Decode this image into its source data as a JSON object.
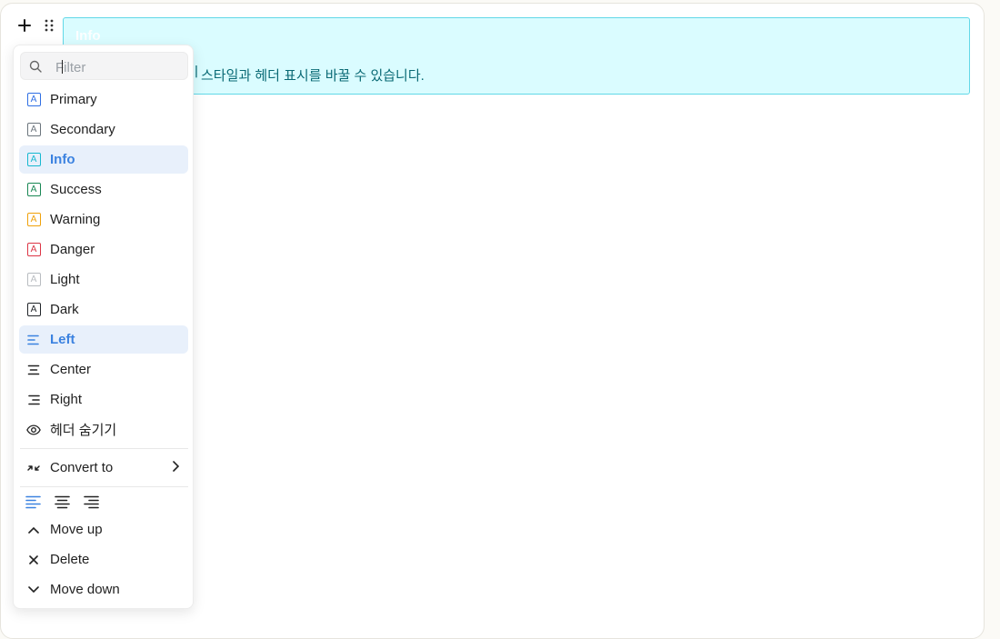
{
  "info_block": {
    "title": "Info",
    "body": "스타일과 헤더 표시를 바꿀 수 있습니다."
  },
  "menu": {
    "filter_placeholder": "Filter",
    "styles": [
      {
        "label": "Primary",
        "color": "#2f6fe4"
      },
      {
        "label": "Secondary",
        "color": "#6c757d"
      },
      {
        "label": "Info",
        "color": "#17b8d0",
        "active": true
      },
      {
        "label": "Success",
        "color": "#198754"
      },
      {
        "label": "Warning",
        "color": "#f0a10a"
      },
      {
        "label": "Danger",
        "color": "#dc3545"
      },
      {
        "label": "Light",
        "color": "#b8bcc0"
      },
      {
        "label": "Dark",
        "color": "#212529"
      }
    ],
    "alignments": [
      {
        "label": "Left",
        "icon": "align-left-icon",
        "active": true
      },
      {
        "label": "Center",
        "icon": "align-center-icon"
      },
      {
        "label": "Right",
        "icon": "align-right-icon"
      }
    ],
    "hide_header": "헤더 숨기기",
    "convert_to": "Convert to",
    "move_up": "Move up",
    "delete": "Delete",
    "move_down": "Move down"
  },
  "colors": {
    "accent": "#3b82e0",
    "active_bg": "#e8f0fb",
    "info_bg": "#dafcff",
    "info_border": "#62d8e8"
  }
}
